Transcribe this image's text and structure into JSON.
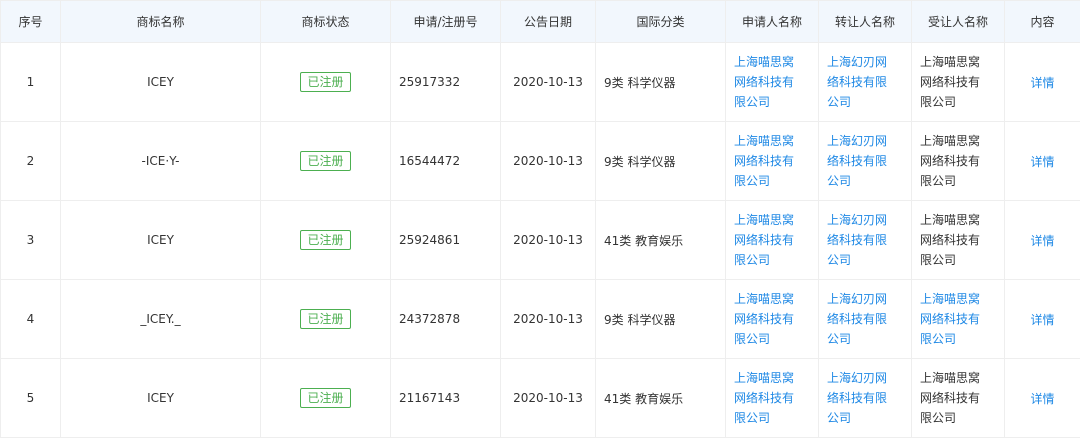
{
  "headers": {
    "index": "序号",
    "name": "商标名称",
    "status": "商标状态",
    "reg_no": "申请/注册号",
    "date": "公告日期",
    "intl_class": "国际分类",
    "applicant": "申请人名称",
    "transferor": "转让人名称",
    "transferee": "受让人名称",
    "content": "内容"
  },
  "colors": {
    "header_bg": "#f2f7fd",
    "link": "#1e88e5",
    "status_green": "#4caf50",
    "border": "#eeeeee"
  },
  "rows": [
    {
      "index": "1",
      "name": "ICEY",
      "status": "已注册",
      "reg_no": "25917332",
      "date": "2020-10-13",
      "intl_class": "9类 科学仪器",
      "applicant": [
        "上海喵思窝",
        "网络科技有",
        "限公司"
      ],
      "transferor": [
        "上海幻刃网",
        "络科技有限",
        "公司"
      ],
      "transferee": [
        "上海喵思窝",
        "网络科技有",
        "限公司"
      ],
      "transferee_is_link": false,
      "content": "详情"
    },
    {
      "index": "2",
      "name": "-ICE·Y-",
      "status": "已注册",
      "reg_no": "16544472",
      "date": "2020-10-13",
      "intl_class": "9类 科学仪器",
      "applicant": [
        "上海喵思窝",
        "网络科技有",
        "限公司"
      ],
      "transferor": [
        "上海幻刃网",
        "络科技有限",
        "公司"
      ],
      "transferee": [
        "上海喵思窝",
        "网络科技有",
        "限公司"
      ],
      "transferee_is_link": false,
      "content": "详情"
    },
    {
      "index": "3",
      "name": "ICEY",
      "status": "已注册",
      "reg_no": "25924861",
      "date": "2020-10-13",
      "intl_class": "41类 教育娱乐",
      "applicant": [
        "上海喵思窝",
        "网络科技有",
        "限公司"
      ],
      "transferor": [
        "上海幻刃网",
        "络科技有限",
        "公司"
      ],
      "transferee": [
        "上海喵思窝",
        "网络科技有",
        "限公司"
      ],
      "transferee_is_link": false,
      "content": "详情"
    },
    {
      "index": "4",
      "name": "_ICEY._",
      "status": "已注册",
      "reg_no": "24372878",
      "date": "2020-10-13",
      "intl_class": "9类 科学仪器",
      "applicant": [
        "上海喵思窝",
        "网络科技有",
        "限公司"
      ],
      "transferor": [
        "上海幻刃网",
        "络科技有限",
        "公司"
      ],
      "transferee": [
        "上海喵思窝",
        "网络科技有",
        "限公司"
      ],
      "transferee_is_link": true,
      "content": "详情"
    },
    {
      "index": "5",
      "name": "ICEY",
      "status": "已注册",
      "reg_no": "21167143",
      "date": "2020-10-13",
      "intl_class": "41类 教育娱乐",
      "applicant": [
        "上海喵思窝",
        "网络科技有",
        "限公司"
      ],
      "transferor": [
        "上海幻刃网",
        "络科技有限",
        "公司"
      ],
      "transferee": [
        "上海喵思窝",
        "网络科技有",
        "限公司"
      ],
      "transferee_is_link": false,
      "content": "详情"
    }
  ]
}
